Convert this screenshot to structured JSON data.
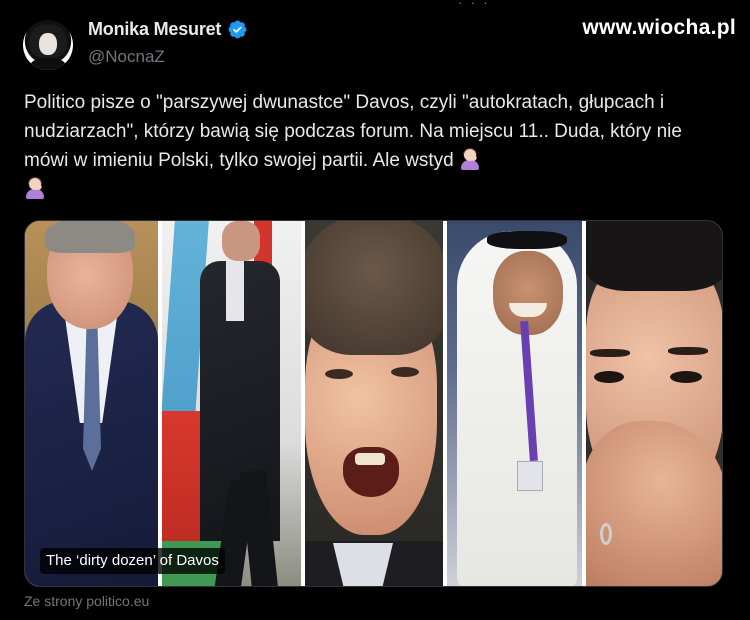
{
  "watermark": "www.wiocha.pl",
  "author": {
    "display_name": "Monika Mesuret",
    "handle": "@NocnaZ",
    "verified_icon": "verified-badge-icon",
    "avatar_icon": "avatar-photo"
  },
  "tweet": {
    "text": "Politico pisze o \"parszywej dwunastce\" Davos, czyli \"autokratach, głupcach i nudziarzach\", którzy bawią się podczas forum. Na miejscu 11.. Duda, który nie mówi w imieniu Polski, tylko swojej partii. Ale wstyd",
    "emoji_name": "woman-facepalming-emoji"
  },
  "media": {
    "caption": "The ‘dirty dozen’ of Davos",
    "source_label": "Ze strony politico.eu"
  },
  "colors": {
    "background": "#000000",
    "text_primary": "#e7e9ea",
    "text_secondary": "#71767b",
    "verified": "#1d9bf0",
    "border": "#2f3336"
  }
}
